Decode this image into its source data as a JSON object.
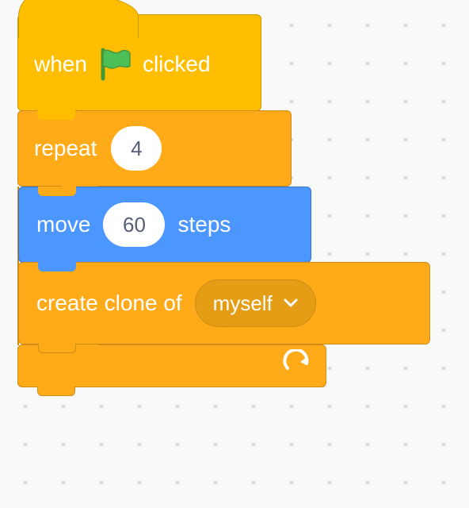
{
  "hat": {
    "prefix": "when",
    "suffix": "clicked"
  },
  "repeat": {
    "label": "repeat",
    "count": "4"
  },
  "move": {
    "prefix": "move",
    "value": "60",
    "suffix": "steps"
  },
  "clone": {
    "label": "create clone of",
    "option": "myself"
  }
}
